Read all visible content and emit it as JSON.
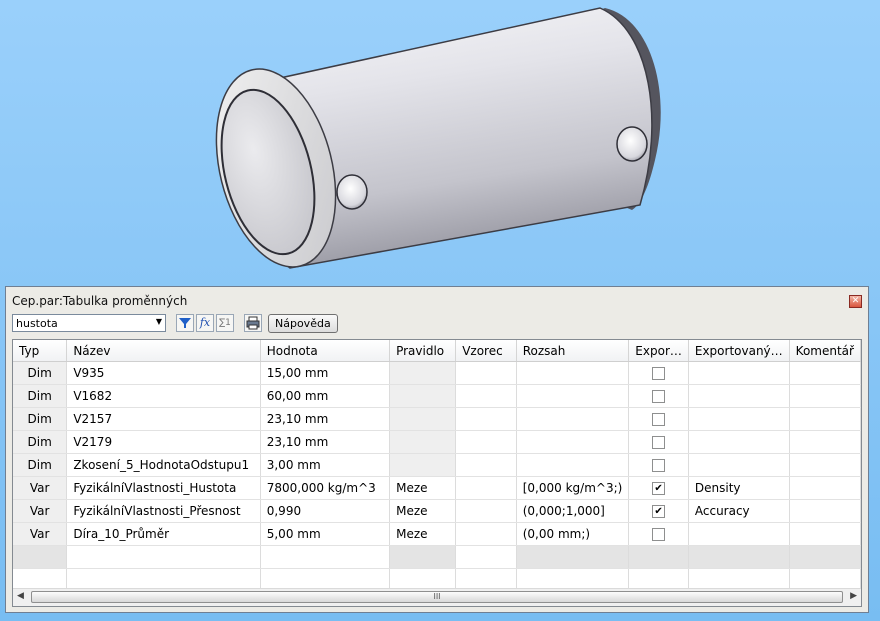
{
  "panel": {
    "title": "Cep.par:Tabulka proměnných",
    "close_glyph": "✕"
  },
  "toolbar": {
    "filter_value": "hustota",
    "dropdown_icon": "chevron-down-icon",
    "filter_icon": "filter-icon",
    "formula_icon": "fx-icon",
    "sum_icon": "sum-icon",
    "print_icon": "printer-icon",
    "fx_label": "fx",
    "sum_label": "∑1",
    "help_label": "Nápověda"
  },
  "table": {
    "columns": [
      "Typ",
      "Název",
      "Hodnota",
      "Pravidlo",
      "Vzorec",
      "Rozsah",
      "Expor…",
      "Exportovaný…",
      "Komentář"
    ],
    "rows": [
      {
        "typ": "Dim",
        "nazev": "V935",
        "hodnota": "15,00 mm",
        "pravidlo": "",
        "vzorec": "",
        "rozsah": "",
        "export": false,
        "exportovany": "",
        "komentar": ""
      },
      {
        "typ": "Dim",
        "nazev": "V1682",
        "hodnota": "60,00 mm",
        "pravidlo": "",
        "vzorec": "",
        "rozsah": "",
        "export": false,
        "exportovany": "",
        "komentar": ""
      },
      {
        "typ": "Dim",
        "nazev": "V2157",
        "hodnota": "23,10 mm",
        "pravidlo": "",
        "vzorec": "",
        "rozsah": "",
        "export": false,
        "exportovany": "",
        "komentar": ""
      },
      {
        "typ": "Dim",
        "nazev": "V2179",
        "hodnota": "23,10 mm",
        "pravidlo": "",
        "vzorec": "",
        "rozsah": "",
        "export": false,
        "exportovany": "",
        "komentar": ""
      },
      {
        "typ": "Dim",
        "nazev": "Zkosení_5_HodnotaOdstupu1",
        "hodnota": "3,00 mm",
        "pravidlo": "",
        "vzorec": "",
        "rozsah": "",
        "export": false,
        "exportovany": "",
        "komentar": ""
      },
      {
        "typ": "Var",
        "nazev": "FyzikálníVlastnosti_Hustota",
        "hodnota": "7800,000 kg/m^3",
        "pravidlo": "Meze",
        "vzorec": "",
        "rozsah": "[0,000 kg/m^3;)",
        "export": true,
        "exportovany": "Density",
        "komentar": ""
      },
      {
        "typ": "Var",
        "nazev": "FyzikálníVlastnosti_Přesnost",
        "hodnota": "0,990",
        "pravidlo": "Meze",
        "vzorec": "",
        "rozsah": "(0,000;1,000]",
        "export": true,
        "exportovany": "Accuracy",
        "komentar": ""
      },
      {
        "typ": "Var",
        "nazev": "Díra_10_Průměr",
        "hodnota": "5,00 mm",
        "pravidlo": "Meze",
        "vzorec": "",
        "rozsah": "(0,00 mm;)",
        "export": false,
        "exportovany": "",
        "komentar": ""
      }
    ]
  },
  "scrollbar": {
    "left_arrow": "◀",
    "right_arrow": "▶",
    "thumb_grip": "III"
  },
  "model": {
    "name": "cylinder-part-3d-icon"
  }
}
